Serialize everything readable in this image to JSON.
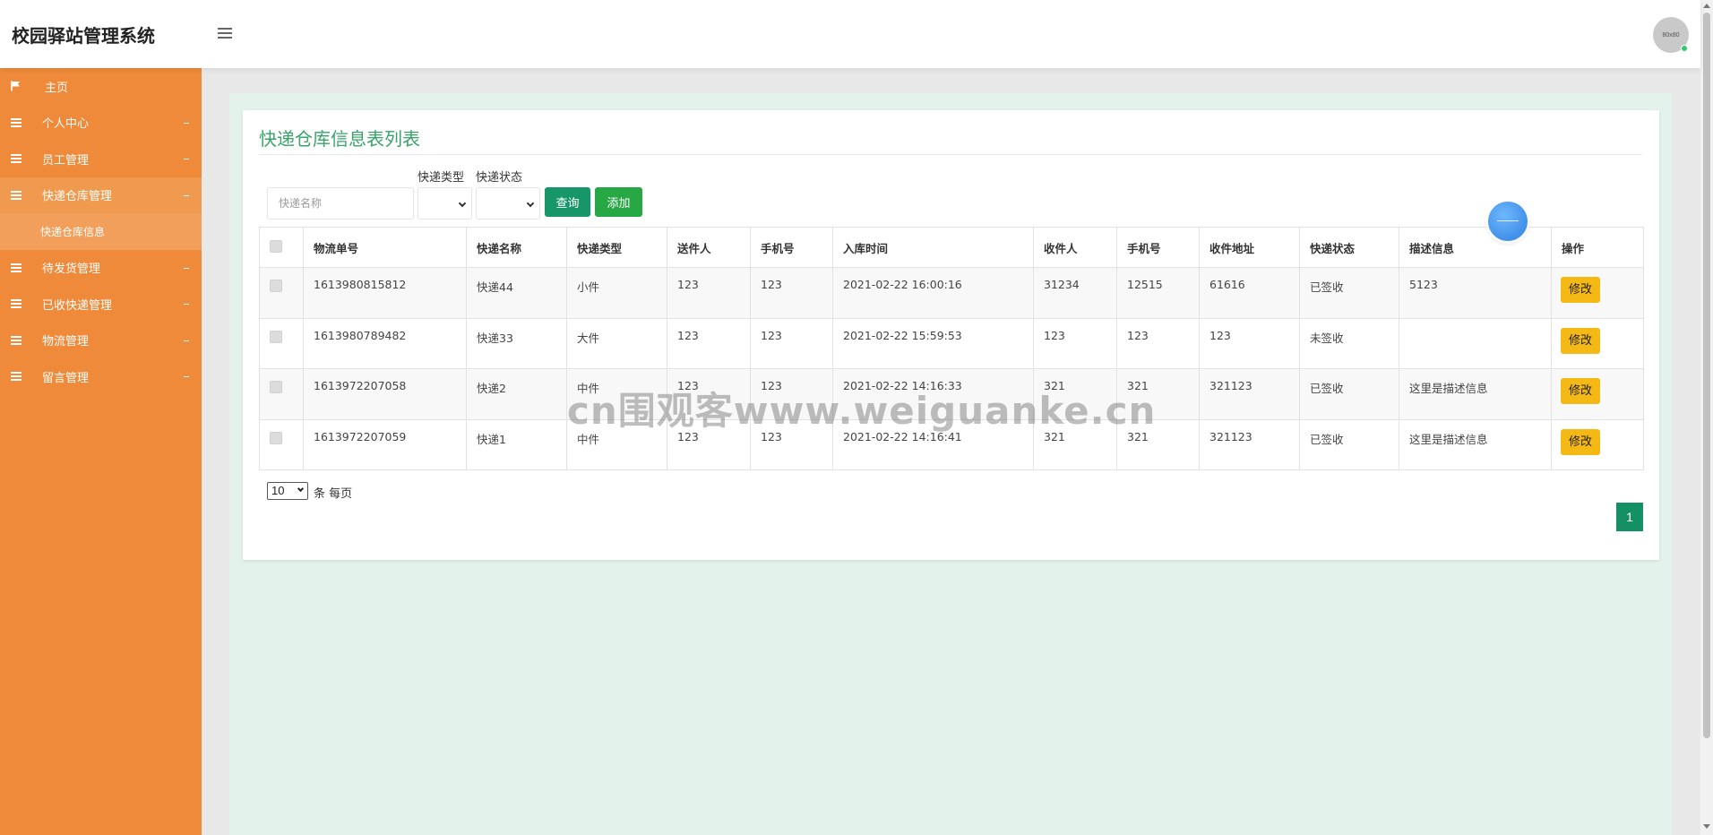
{
  "app": {
    "title": "校园驿站管理系统",
    "avatar_text": "80x80"
  },
  "sidebar": {
    "items": [
      {
        "label": "主页",
        "icon": "flag-icon"
      },
      {
        "label": "个人中心",
        "icon": "list-icon"
      },
      {
        "label": "员工管理",
        "icon": "list-icon"
      },
      {
        "label": "快递仓库管理",
        "icon": "list-icon",
        "active": true
      },
      {
        "label": "待发货管理",
        "icon": "list-icon"
      },
      {
        "label": "已收快递管理",
        "icon": "list-icon"
      },
      {
        "label": "物流管理",
        "icon": "list-icon"
      },
      {
        "label": "留言管理",
        "icon": "list-icon"
      }
    ],
    "sub_item": "快递仓库信息"
  },
  "page": {
    "title": "快递仓库信息表列表",
    "search_placeholder": "快递名称",
    "filter_type_label": "快递类型",
    "filter_status_label": "快递状态",
    "query_button": "查询",
    "add_button": "添加",
    "per_page_value": "10",
    "per_page_label": "条 每页",
    "current_page": "1",
    "watermark": "cn围观客www.weiguanke.cn"
  },
  "table": {
    "headers": [
      "物流单号",
      "快递名称",
      "快递类型",
      "送件人",
      "手机号",
      "入库时间",
      "收件人",
      "手机号",
      "收件地址",
      "快递状态",
      "描述信息",
      "操作"
    ],
    "rows": [
      [
        "1613980815812",
        "快递44",
        "小件",
        "123",
        "123",
        "2021-02-22 16:00:16",
        "31234",
        "12515",
        "61616",
        "已签收",
        "5123"
      ],
      [
        "1613980789482",
        "快递33",
        "大件",
        "123",
        "123",
        "2021-02-22 15:59:53",
        "123",
        "123",
        "123",
        "未签收",
        ""
      ],
      [
        "1613972207058",
        "快递2",
        "中件",
        "123",
        "123",
        "2021-02-22 14:16:33",
        "321",
        "321",
        "321123",
        "已签收",
        "这里是描述信息"
      ],
      [
        "1613972207059",
        "快递1",
        "中件",
        "123",
        "123",
        "2021-02-22 14:16:41",
        "321",
        "321",
        "321123",
        "已签收",
        "这里是描述信息"
      ]
    ],
    "edit_label": "修改"
  },
  "colors": {
    "sidebar": "#ee8a3a",
    "accent_green": "#3aa36b",
    "edit_button": "#f5b916"
  }
}
